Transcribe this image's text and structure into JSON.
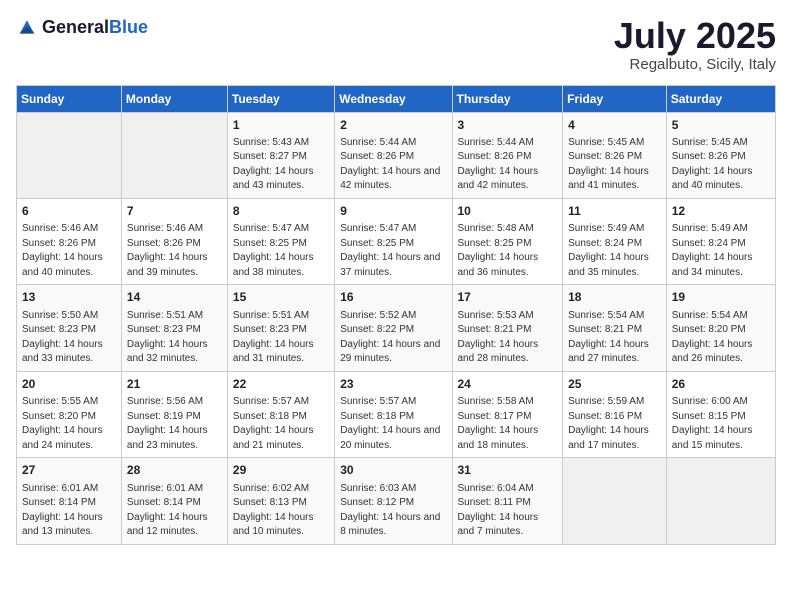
{
  "header": {
    "logo_general": "General",
    "logo_blue": "Blue",
    "month": "July 2025",
    "location": "Regalbuto, Sicily, Italy"
  },
  "columns": [
    "Sunday",
    "Monday",
    "Tuesday",
    "Wednesday",
    "Thursday",
    "Friday",
    "Saturday"
  ],
  "rows": [
    [
      {
        "day": "",
        "content": ""
      },
      {
        "day": "",
        "content": ""
      },
      {
        "day": "1",
        "content": "Sunrise: 5:43 AM\nSunset: 8:27 PM\nDaylight: 14 hours and 43 minutes."
      },
      {
        "day": "2",
        "content": "Sunrise: 5:44 AM\nSunset: 8:26 PM\nDaylight: 14 hours and 42 minutes."
      },
      {
        "day": "3",
        "content": "Sunrise: 5:44 AM\nSunset: 8:26 PM\nDaylight: 14 hours and 42 minutes."
      },
      {
        "day": "4",
        "content": "Sunrise: 5:45 AM\nSunset: 8:26 PM\nDaylight: 14 hours and 41 minutes."
      },
      {
        "day": "5",
        "content": "Sunrise: 5:45 AM\nSunset: 8:26 PM\nDaylight: 14 hours and 40 minutes."
      }
    ],
    [
      {
        "day": "6",
        "content": "Sunrise: 5:46 AM\nSunset: 8:26 PM\nDaylight: 14 hours and 40 minutes."
      },
      {
        "day": "7",
        "content": "Sunrise: 5:46 AM\nSunset: 8:26 PM\nDaylight: 14 hours and 39 minutes."
      },
      {
        "day": "8",
        "content": "Sunrise: 5:47 AM\nSunset: 8:25 PM\nDaylight: 14 hours and 38 minutes."
      },
      {
        "day": "9",
        "content": "Sunrise: 5:47 AM\nSunset: 8:25 PM\nDaylight: 14 hours and 37 minutes."
      },
      {
        "day": "10",
        "content": "Sunrise: 5:48 AM\nSunset: 8:25 PM\nDaylight: 14 hours and 36 minutes."
      },
      {
        "day": "11",
        "content": "Sunrise: 5:49 AM\nSunset: 8:24 PM\nDaylight: 14 hours and 35 minutes."
      },
      {
        "day": "12",
        "content": "Sunrise: 5:49 AM\nSunset: 8:24 PM\nDaylight: 14 hours and 34 minutes."
      }
    ],
    [
      {
        "day": "13",
        "content": "Sunrise: 5:50 AM\nSunset: 8:23 PM\nDaylight: 14 hours and 33 minutes."
      },
      {
        "day": "14",
        "content": "Sunrise: 5:51 AM\nSunset: 8:23 PM\nDaylight: 14 hours and 32 minutes."
      },
      {
        "day": "15",
        "content": "Sunrise: 5:51 AM\nSunset: 8:23 PM\nDaylight: 14 hours and 31 minutes."
      },
      {
        "day": "16",
        "content": "Sunrise: 5:52 AM\nSunset: 8:22 PM\nDaylight: 14 hours and 29 minutes."
      },
      {
        "day": "17",
        "content": "Sunrise: 5:53 AM\nSunset: 8:21 PM\nDaylight: 14 hours and 28 minutes."
      },
      {
        "day": "18",
        "content": "Sunrise: 5:54 AM\nSunset: 8:21 PM\nDaylight: 14 hours and 27 minutes."
      },
      {
        "day": "19",
        "content": "Sunrise: 5:54 AM\nSunset: 8:20 PM\nDaylight: 14 hours and 26 minutes."
      }
    ],
    [
      {
        "day": "20",
        "content": "Sunrise: 5:55 AM\nSunset: 8:20 PM\nDaylight: 14 hours and 24 minutes."
      },
      {
        "day": "21",
        "content": "Sunrise: 5:56 AM\nSunset: 8:19 PM\nDaylight: 14 hours and 23 minutes."
      },
      {
        "day": "22",
        "content": "Sunrise: 5:57 AM\nSunset: 8:18 PM\nDaylight: 14 hours and 21 minutes."
      },
      {
        "day": "23",
        "content": "Sunrise: 5:57 AM\nSunset: 8:18 PM\nDaylight: 14 hours and 20 minutes."
      },
      {
        "day": "24",
        "content": "Sunrise: 5:58 AM\nSunset: 8:17 PM\nDaylight: 14 hours and 18 minutes."
      },
      {
        "day": "25",
        "content": "Sunrise: 5:59 AM\nSunset: 8:16 PM\nDaylight: 14 hours and 17 minutes."
      },
      {
        "day": "26",
        "content": "Sunrise: 6:00 AM\nSunset: 8:15 PM\nDaylight: 14 hours and 15 minutes."
      }
    ],
    [
      {
        "day": "27",
        "content": "Sunrise: 6:01 AM\nSunset: 8:14 PM\nDaylight: 14 hours and 13 minutes."
      },
      {
        "day": "28",
        "content": "Sunrise: 6:01 AM\nSunset: 8:14 PM\nDaylight: 14 hours and 12 minutes."
      },
      {
        "day": "29",
        "content": "Sunrise: 6:02 AM\nSunset: 8:13 PM\nDaylight: 14 hours and 10 minutes."
      },
      {
        "day": "30",
        "content": "Sunrise: 6:03 AM\nSunset: 8:12 PM\nDaylight: 14 hours and 8 minutes."
      },
      {
        "day": "31",
        "content": "Sunrise: 6:04 AM\nSunset: 8:11 PM\nDaylight: 14 hours and 7 minutes."
      },
      {
        "day": "",
        "content": ""
      },
      {
        "day": "",
        "content": ""
      }
    ]
  ]
}
